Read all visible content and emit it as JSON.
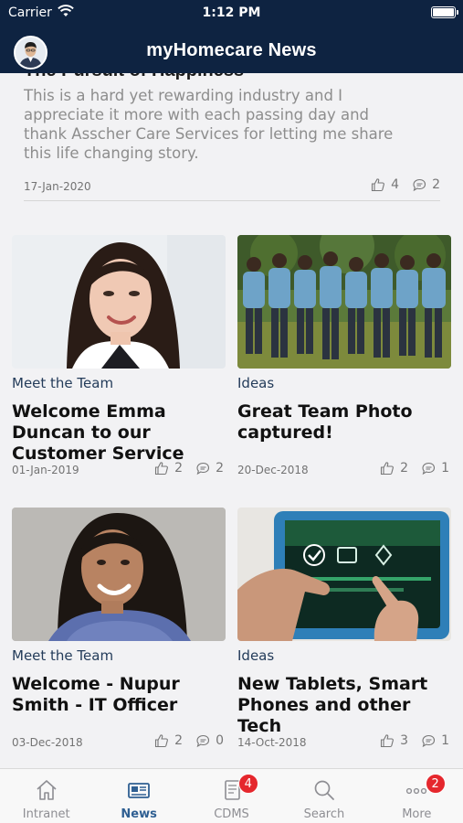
{
  "status_bar": {
    "carrier": "Carrier",
    "time": "1:12 PM"
  },
  "header": {
    "title": "myHomecare News"
  },
  "top_article": {
    "title": "The Pursuit of Happiness",
    "body": "This is a hard yet rewarding industry and I appreciate it more with each passing day and thank Asscher Care Services for letting me share this life changing story.",
    "date": "17-Jan-2020",
    "likes": "4",
    "comments": "2"
  },
  "cards": [
    {
      "category": "Meet the Team",
      "title": "Welcome Emma Duncan to our Customer Service",
      "date": "01-Jan-2019",
      "likes": "2",
      "comments": "2",
      "image": "portrait-woman-dark-hair"
    },
    {
      "category": "Ideas",
      "title": "Great Team Photo captured!",
      "date": "20-Dec-2018",
      "likes": "2",
      "comments": "1",
      "image": "team-group-outdoors"
    },
    {
      "category": "Meet the Team",
      "title": "Welcome - Nupur Smith - IT Officer",
      "date": "03-Dec-2018",
      "likes": "2",
      "comments": "0",
      "image": "portrait-woman-smiling"
    },
    {
      "category": "Ideas",
      "title": "New Tablets, Smart Phones and other Tech",
      "date": "14-Oct-2018",
      "likes": "3",
      "comments": "1",
      "image": "tablet-device-in-hands"
    }
  ],
  "tabs": [
    {
      "label": "Intranet",
      "icon": "house-icon"
    },
    {
      "label": "News",
      "icon": "newspaper-icon",
      "active": true
    },
    {
      "label": "CDMS",
      "icon": "document-icon",
      "badge": "4"
    },
    {
      "label": "Search",
      "icon": "search-icon"
    },
    {
      "label": "More",
      "icon": "more-dots-icon",
      "badge": "2"
    }
  ],
  "colors": {
    "header_bg": "#0e2341",
    "active_tab": "#2f5f92",
    "badge": "#e5272d",
    "category_text": "#243c5a"
  }
}
